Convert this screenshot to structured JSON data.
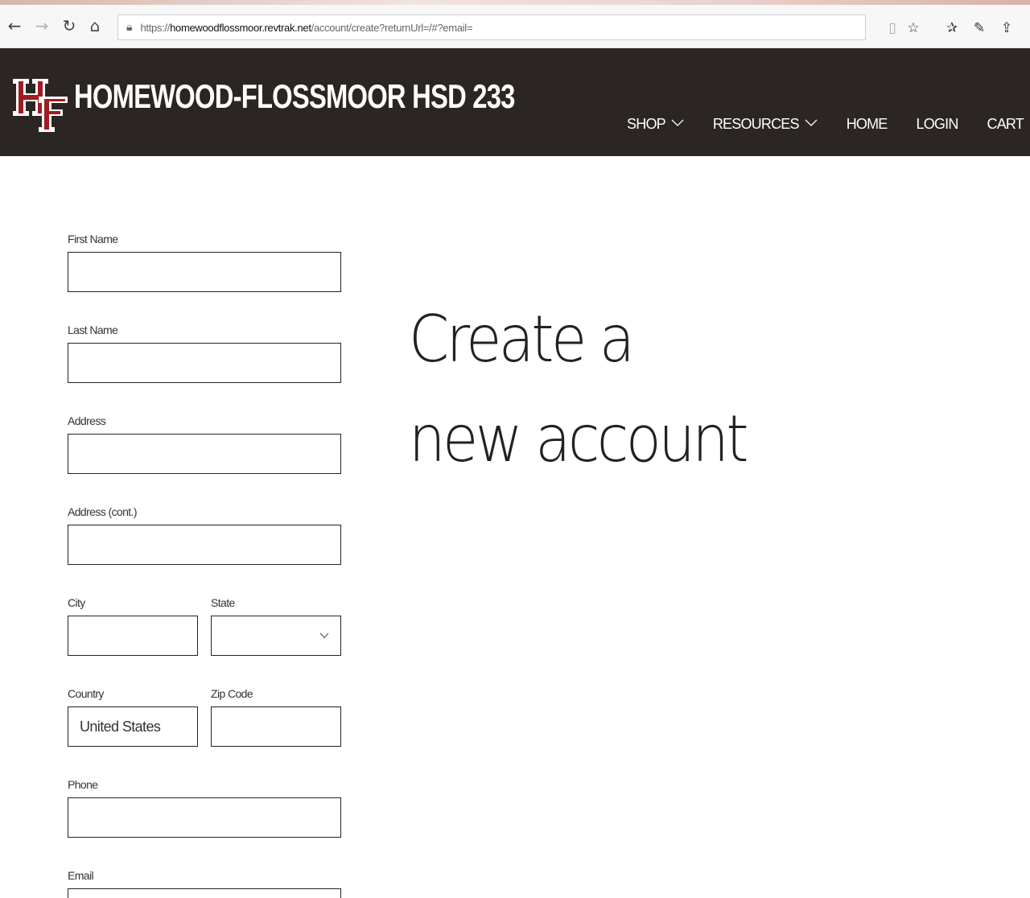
{
  "browser": {
    "url_prefix": "https://",
    "url_host": "homewoodflossmoor.revtrak.net",
    "url_path": "/account/create?returnUrl=/#?email="
  },
  "header": {
    "logo_text": "HF",
    "site_title": "HOMEWOOD-FLOSSMOOR HSD 233",
    "brand_color": "#2b2624",
    "logo_red": "#a11b22",
    "nav": [
      {
        "label": "SHOP",
        "has_dropdown": true
      },
      {
        "label": "RESOURCES",
        "has_dropdown": true
      },
      {
        "label": "HOME",
        "has_dropdown": false
      },
      {
        "label": "LOGIN",
        "has_dropdown": false
      },
      {
        "label": "CART",
        "has_dropdown": false
      }
    ]
  },
  "form": {
    "first_name": {
      "label": "First Name",
      "value": ""
    },
    "last_name": {
      "label": "Last Name",
      "value": ""
    },
    "address": {
      "label": "Address",
      "value": ""
    },
    "address_cont": {
      "label": "Address (cont.)",
      "value": ""
    },
    "city": {
      "label": "City",
      "value": ""
    },
    "state": {
      "label": "State",
      "value": ""
    },
    "country": {
      "label": "Country",
      "value": "United States"
    },
    "zip": {
      "label": "Zip Code",
      "value": ""
    },
    "phone": {
      "label": "Phone",
      "value": ""
    },
    "email": {
      "label": "Email",
      "value": ""
    }
  },
  "hero": {
    "line1": "Create a",
    "line2": "new account"
  }
}
